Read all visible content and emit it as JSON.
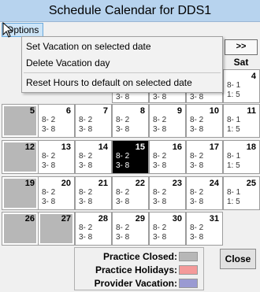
{
  "window": {
    "title": "Schedule Calendar for DDS1"
  },
  "menu": {
    "options_label": "Options"
  },
  "nav": {
    "next_label": ">>",
    "sat_header": "Sat"
  },
  "dropdown": {
    "items": [
      "Set Vacation on selected date",
      "Delete Vacation day",
      "Reset Hours to default on selected date"
    ]
  },
  "calendar": {
    "partial_row": {
      "hours": [
        "3- 8",
        "3- 8",
        "3- 8"
      ],
      "sat": {
        "day": "4",
        "lines": [
          "8- 1",
          "1: 5"
        ]
      }
    },
    "weeks": [
      [
        {
          "day": "5",
          "style": "grey"
        },
        {
          "day": "6",
          "lines": [
            "8- 2",
            "3- 8"
          ]
        },
        {
          "day": "7",
          "lines": [
            "8- 2",
            "3- 8"
          ]
        },
        {
          "day": "8",
          "lines": [
            "8- 2",
            "3- 8"
          ]
        },
        {
          "day": "9",
          "lines": [
            "8- 2",
            "3- 8"
          ]
        },
        {
          "day": "10",
          "lines": [
            "8- 2",
            "3- 8"
          ]
        },
        {
          "day": "11",
          "lines": [
            "8- 1",
            "1: 5"
          ]
        }
      ],
      [
        {
          "day": "12",
          "style": "grey"
        },
        {
          "day": "13",
          "lines": [
            "8- 2",
            "3- 8"
          ]
        },
        {
          "day": "14",
          "lines": [
            "8- 2",
            "3- 8"
          ]
        },
        {
          "day": "15",
          "style": "selected",
          "lines": [
            "8- 2",
            "3- 8"
          ]
        },
        {
          "day": "16",
          "lines": [
            "8- 2",
            "3- 8"
          ]
        },
        {
          "day": "17",
          "lines": [
            "8- 2",
            "3- 8"
          ]
        },
        {
          "day": "18",
          "lines": [
            "8- 1",
            "1: 5"
          ]
        }
      ],
      [
        {
          "day": "19",
          "style": "grey"
        },
        {
          "day": "20",
          "lines": [
            "8- 2",
            "3- 8"
          ]
        },
        {
          "day": "21",
          "lines": [
            "8- 2",
            "3- 8"
          ]
        },
        {
          "day": "22",
          "lines": [
            "8- 2",
            "3- 8"
          ]
        },
        {
          "day": "23",
          "lines": [
            "8- 2",
            "3- 8"
          ]
        },
        {
          "day": "24",
          "lines": [
            "8- 2",
            "3- 8"
          ]
        },
        {
          "day": "25",
          "lines": [
            "8- 1",
            "1: 5"
          ]
        }
      ],
      [
        {
          "day": "26",
          "style": "grey"
        },
        {
          "day": "27",
          "style": "grey"
        },
        {
          "day": "28",
          "lines": [
            "8- 2",
            "3- 8"
          ]
        },
        {
          "day": "29",
          "lines": [
            "8- 2",
            "3- 8"
          ]
        },
        {
          "day": "30",
          "lines": [
            "8- 2",
            "3- 8"
          ]
        },
        {
          "day": "31",
          "lines": [
            "8- 2",
            "3- 8"
          ]
        }
      ]
    ]
  },
  "legend": {
    "items": [
      {
        "label": "Practice Closed:",
        "color": "#b7b7b7"
      },
      {
        "label": "Practice Holidays:",
        "color": "#f49a9a"
      },
      {
        "label": "Provider Vacation:",
        "color": "#9a9ad2"
      }
    ]
  },
  "buttons": {
    "close_label": "Close"
  }
}
